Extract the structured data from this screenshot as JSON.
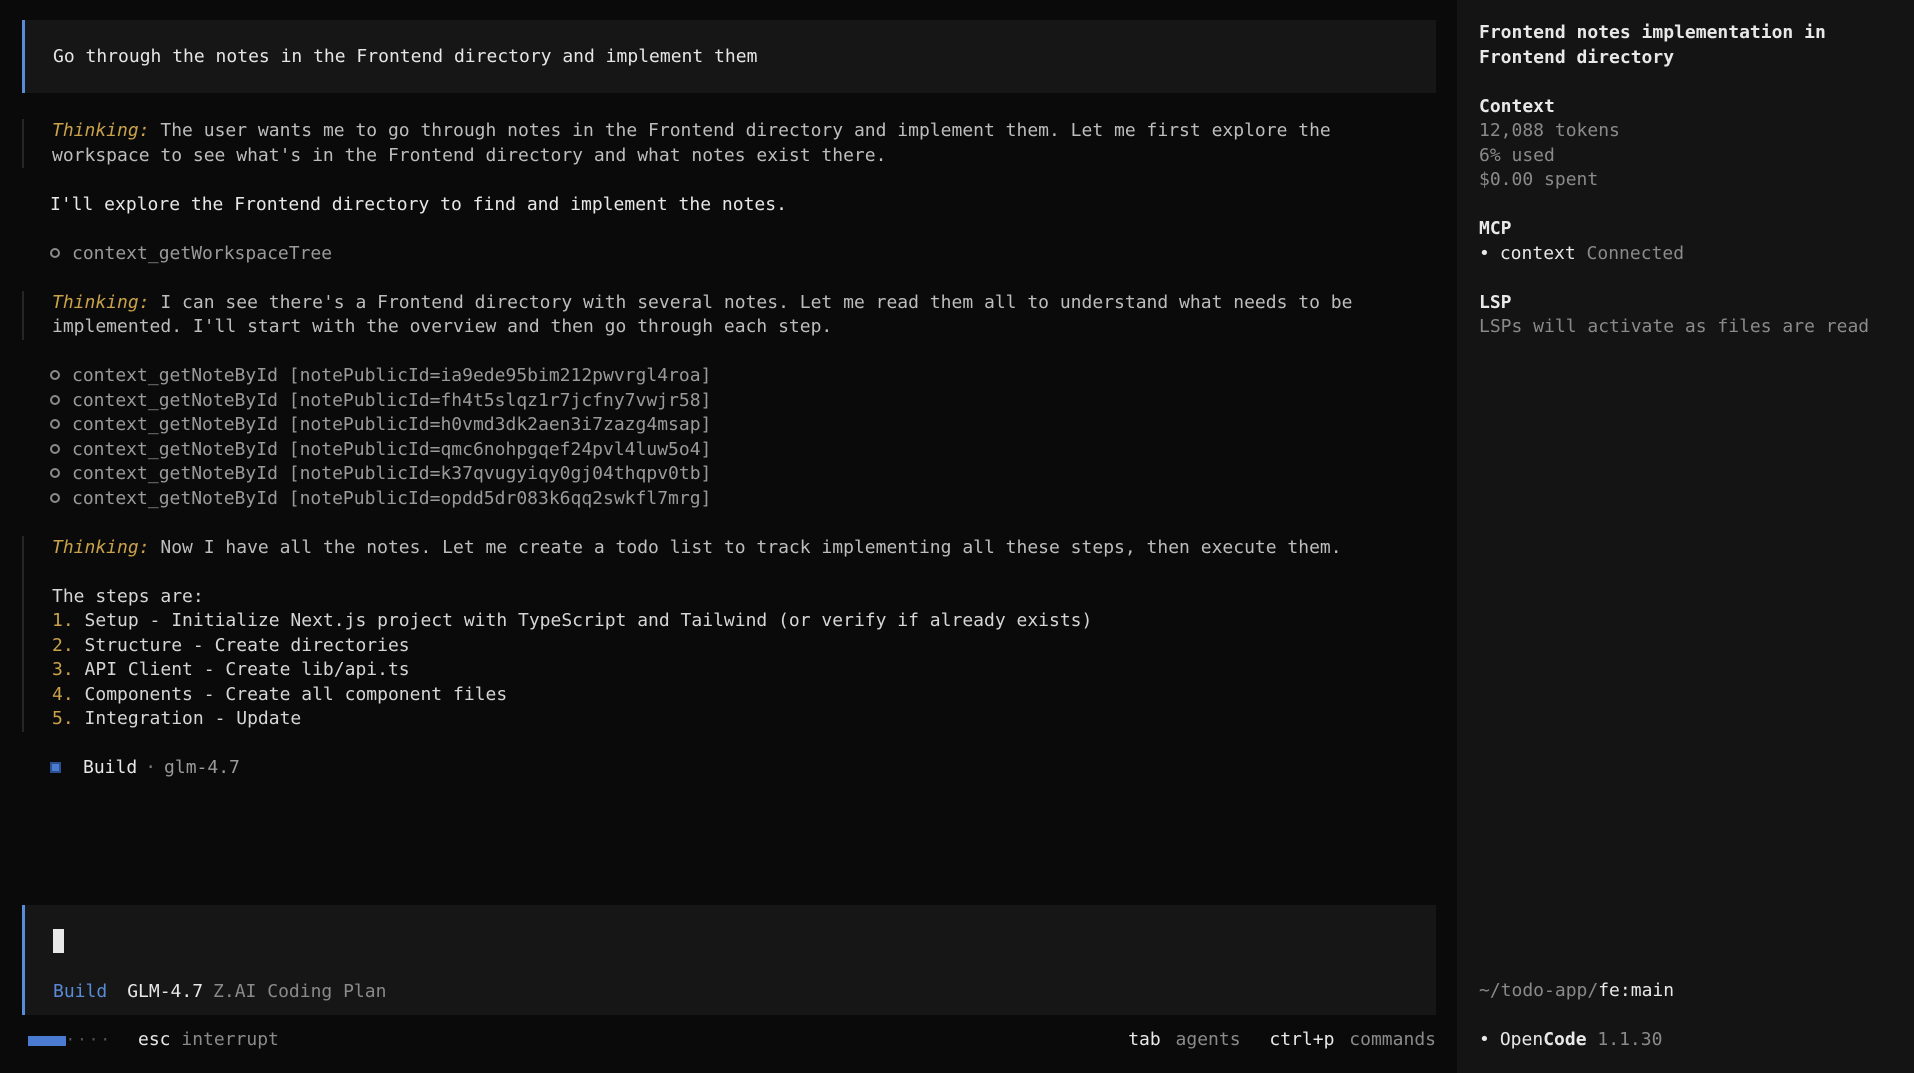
{
  "user_message": "Go through the notes in the Frontend directory and implement them",
  "thinking_label": "Thinking:",
  "thread": {
    "thinking1": {
      "line1": " The user wants me to go through notes in the Frontend directory and implement them. Let me first explore the",
      "line2": "workspace to see what's in the Frontend directory and what notes exist there."
    },
    "reply1": "I'll explore the Frontend directory to find and implement the notes.",
    "tool1": "context_getWorkspaceTree",
    "thinking2": {
      "line1": " I can see there's a Frontend directory with several notes. Let me read them all to understand what needs to be",
      "line2": "implemented. I'll start with the overview and then go through each step."
    },
    "tool_calls": [
      "context_getNoteById [notePublicId=ia9ede95bim212pwvrgl4roa]",
      "context_getNoteById [notePublicId=fh4t5slqz1r7jcfny7vwjr58]",
      "context_getNoteById [notePublicId=h0vmd3dk2aen3i7zazg4msap]",
      "context_getNoteById [notePublicId=qmc6nohpgqef24pvl4luw5o4]",
      "context_getNoteById [notePublicId=k37qvugyiqy0gj04thqpv0tb]",
      "context_getNoteById [notePublicId=opdd5dr083k6qq2swkfl7mrg]"
    ],
    "thinking3": {
      "line1": " Now I have all the notes. Let me create a todo list to track implementing all these steps, then execute them.",
      "steps_intro": "The steps are:",
      "steps": [
        {
          "num": "1.",
          "text": " Setup - Initialize Next.js project with TypeScript and Tailwind (or verify if already exists)"
        },
        {
          "num": "2.",
          "text": " Structure - Create directories"
        },
        {
          "num": "3.",
          "text": " API Client - Create lib/api.ts"
        },
        {
          "num": "4.",
          "text": " Components - Create all component files"
        },
        {
          "num": "5.",
          "text": " Integration - Update"
        }
      ]
    },
    "build": {
      "agent": "Build",
      "sep": "·",
      "model": "glm-4.7"
    }
  },
  "input": {
    "agent": "Build",
    "model": "GLM-4.7",
    "provider": "Z.AI Coding Plan"
  },
  "status": {
    "progress": 0.45,
    "progress_dots": "····",
    "esc_key": "esc",
    "esc_desc": "interrupt",
    "tab_key": "tab",
    "tab_desc": "agents",
    "cmd_key": "ctrl+p",
    "cmd_desc": "commands"
  },
  "sidebar": {
    "title": "Frontend notes implementation in Frontend directory",
    "context": {
      "heading": "Context",
      "tokens": "12,088 tokens",
      "used": "6% used",
      "spent": "$0.00 spent"
    },
    "mcp": {
      "heading": "MCP",
      "bullet": "•",
      "server": "context",
      "state": "Connected"
    },
    "lsp": {
      "heading": "LSP",
      "text": "LSPs will activate as files are read"
    },
    "path": {
      "dir": "~/todo-app/",
      "branch": "fe:main"
    },
    "version": {
      "bullet": "•",
      "name_a": "Open",
      "name_b": "Code",
      "number": "1.1.30"
    }
  },
  "colors": {
    "accent": "#5a8bd6",
    "thinking_label": "#c9a24a",
    "background": "#0a0a0a",
    "sidebar": "#141414"
  }
}
